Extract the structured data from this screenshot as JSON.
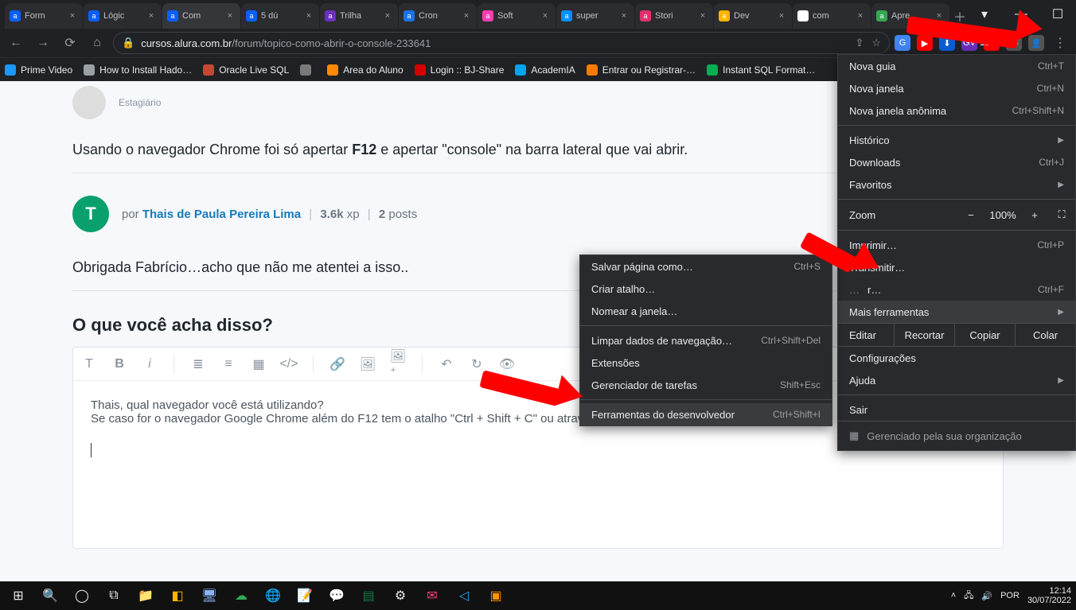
{
  "tabs": [
    {
      "label": "Form",
      "fav": "#0a5fff",
      "active": false
    },
    {
      "label": "Lógic",
      "fav": "#0a5fff",
      "active": false
    },
    {
      "label": "Com",
      "fav": "#0a5fff",
      "active": true
    },
    {
      "label": "5 dú",
      "fav": "#0a5fff",
      "active": false
    },
    {
      "label": "Trilha",
      "fav": "#6b2fbd",
      "active": false
    },
    {
      "label": "Cron",
      "fav": "#1a73e8",
      "active": false
    },
    {
      "label": "Soft",
      "fav": "#ff3db0",
      "active": false
    },
    {
      "label": "super",
      "fav": "#0090ff",
      "active": false
    },
    {
      "label": "Stori",
      "fav": "#e1306c",
      "active": false
    },
    {
      "label": "Dev",
      "fav": "#ffb400",
      "active": false
    },
    {
      "label": "com",
      "fav": "#ffffff",
      "active": false
    },
    {
      "label": "Apre",
      "fav": "#34a853",
      "active": false
    }
  ],
  "url": {
    "host": "cursos.alura.com.br",
    "path": "/forum/topico-como-abrir-o-console-233641"
  },
  "ext_icons": [
    {
      "bg": "#4285f4",
      "txt": "G"
    },
    {
      "bg": "#ff0000",
      "txt": "▶"
    },
    {
      "bg": "#0b5ed7",
      "txt": "⬇"
    },
    {
      "bg": "#6b2fbd",
      "txt": "GV"
    },
    {
      "bg": "#ff0000",
      "txt": "15min"
    },
    {
      "bg": "#555",
      "txt": "🧩"
    },
    {
      "bg": "#555",
      "txt": "👤"
    }
  ],
  "bookmarks": [
    {
      "label": "Prime Video",
      "fav": "#1a98ff"
    },
    {
      "label": "How to Install Hado…",
      "fav": "#9aa0a6"
    },
    {
      "label": "Oracle Live SQL",
      "fav": "#c74634"
    },
    {
      "label": "",
      "fav": "#7a7a7a"
    },
    {
      "label": "Area do Aluno",
      "fav": "#ff8a00"
    },
    {
      "label": "Login :: BJ-Share",
      "fav": "#d40000"
    },
    {
      "label": "AcademIA",
      "fav": "#00a4ef"
    },
    {
      "label": "Entrar ou Registrar-…",
      "fav": "#ff7a00"
    },
    {
      "label": "Instant SQL Format…",
      "fav": "#00b050"
    }
  ],
  "post1": {
    "role": "Estagiário",
    "body_pre": "Usando o navegador Chrome foi só apertar ",
    "body_kbd": "F12",
    "body_post": " e apertar \"console\" na barra lateral que vai abrir."
  },
  "post2": {
    "avatar_letter": "T",
    "by_prefix": "por ",
    "author": "Thais de Paula Pereira Lima",
    "xp_value": "3.6k",
    "xp_label": "xp",
    "posts_value": "2",
    "posts_label": "posts",
    "body": "Obrigada Fabrício…acho que não me atentei a isso.."
  },
  "question_title": "O que você acha disso?",
  "editor": {
    "line1": "Thais, qual navegador você está utilizando?",
    "line2": "Se caso for o navegador Google Chrome além do F12 tem o atalho \"Ctrl + Shift + C\" ou através do menu conforme imagem abaixo:"
  },
  "main_menu": {
    "items_top": [
      {
        "label": "Nova guia",
        "shortcut": "Ctrl+T"
      },
      {
        "label": "Nova janela",
        "shortcut": "Ctrl+N"
      },
      {
        "label": "Nova janela anônima",
        "shortcut": "Ctrl+Shift+N"
      }
    ],
    "history": {
      "label": "Histórico"
    },
    "downloads": {
      "label": "Downloads",
      "shortcut": "Ctrl+J"
    },
    "favorites": {
      "label": "Favoritos"
    },
    "zoom": {
      "label": "Zoom",
      "minus": "−",
      "value": "100%",
      "plus": "+"
    },
    "print": {
      "label": "Imprimir…",
      "shortcut": "Ctrl+P"
    },
    "cast": {
      "label": "Transmitir…"
    },
    "find": {
      "label_partial": "r…",
      "shortcut": "Ctrl+F"
    },
    "more_tools": {
      "label": "Mais ferramentas"
    },
    "edit": {
      "label": "Editar",
      "cut": "Recortar",
      "copy": "Copiar",
      "paste": "Colar"
    },
    "settings": {
      "label": "Configurações"
    },
    "help": {
      "label": "Ajuda"
    },
    "exit": {
      "label": "Sair"
    },
    "managed": "Gerenciado pela sua organização"
  },
  "sub_menu": {
    "items": [
      {
        "label": "Salvar página como…",
        "shortcut": "Ctrl+S"
      },
      {
        "label": "Criar atalho…",
        "shortcut": ""
      },
      {
        "label": "Nomear a janela…",
        "shortcut": ""
      }
    ],
    "items2": [
      {
        "label": "Limpar dados de navegação…",
        "shortcut": "Ctrl+Shift+Del"
      },
      {
        "label": "Extensões",
        "shortcut": ""
      },
      {
        "label": "Gerenciador de tarefas",
        "shortcut": "Shift+Esc"
      }
    ],
    "devtools": {
      "label": "Ferramentas do desenvolvedor",
      "shortcut": "Ctrl+Shift+I"
    }
  },
  "taskbar": {
    "time": "12:14",
    "date": "30/07/2022"
  }
}
